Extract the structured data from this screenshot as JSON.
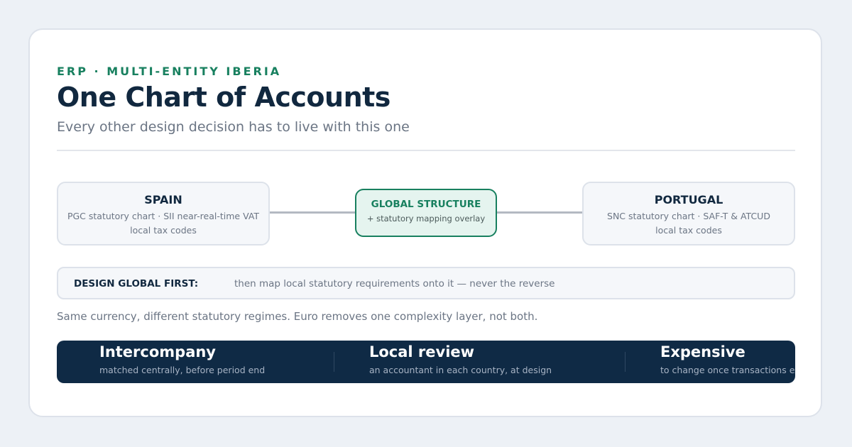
{
  "header": {
    "eyebrow": "ERP · MULTI-ENTITY IBERIA",
    "title": "One Chart of Accounts",
    "subtitle": "Every other design decision has to live with this one"
  },
  "diagram": {
    "left": {
      "name": "SPAIN",
      "line1": "PGC statutory chart · SII near-real-time VAT",
      "line2": "local tax codes"
    },
    "center": {
      "name": "GLOBAL STRUCTURE",
      "sub": "+ statutory mapping overlay"
    },
    "right": {
      "name": "PORTUGAL",
      "line1": "SNC statutory chart · SAF-T & ATCUD",
      "line2": "local tax codes"
    }
  },
  "principle": {
    "label": "DESIGN GLOBAL FIRST:",
    "text": "then map local statutory requirements onto it — never the reverse"
  },
  "note": "Same currency, different statutory regimes. Euro removes one complexity layer, not both.",
  "stats": [
    {
      "title": "Intercompany",
      "detail": "matched centrally, before period end"
    },
    {
      "title": "Local review",
      "detail": "an accountant in each country, at design"
    },
    {
      "title": "Expensive",
      "detail": "to change once transactions exist"
    }
  ],
  "colors": {
    "accent": "#18805f",
    "navy": "#0f2a45",
    "background": "#edf1f6"
  }
}
